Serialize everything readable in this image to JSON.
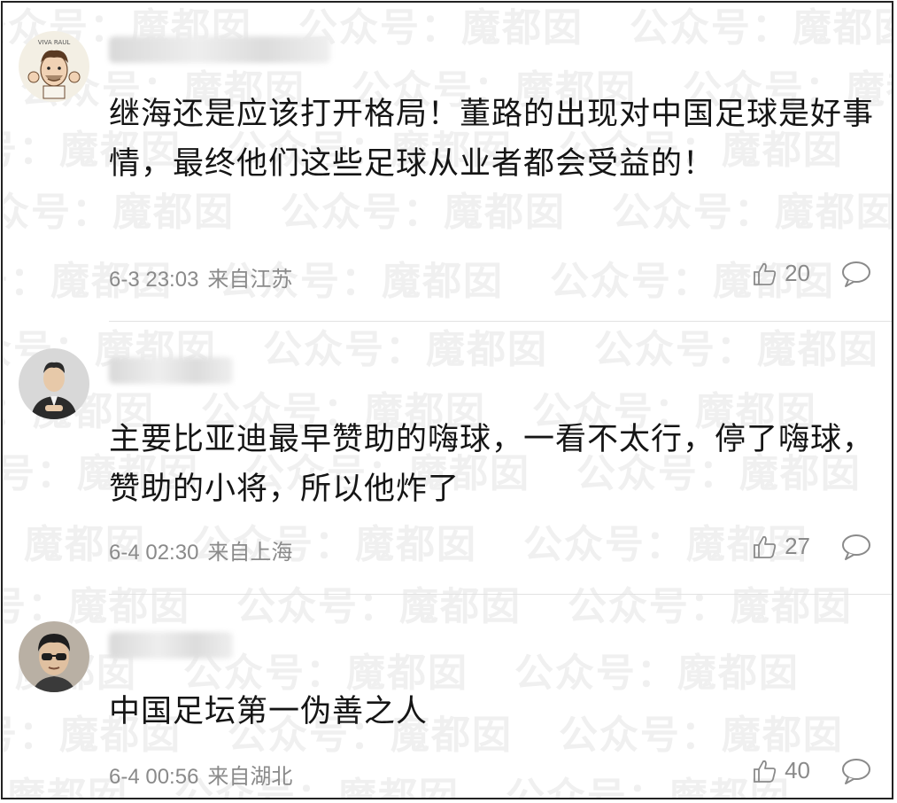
{
  "watermark": {
    "text": "公众号：魔都囡"
  },
  "comments": [
    {
      "avatar_caption": "VIVA RAUL",
      "text": "继海还是应该打开格局！董路的出现对中国足球是好事情，最终他们这些足球从业者都会受益的！",
      "time": "6-3 23:03",
      "location": "来自江苏",
      "likes": "20",
      "colors": {
        "avatar_bg": "#f3efe4",
        "avatar_fg": "#6b4a2f"
      }
    },
    {
      "text": "主要比亚迪最早赞助的嗨球，一看不太行，停了嗨球，赞助的小将，所以他炸了",
      "time": "6-4 02:30",
      "location": "来自上海",
      "likes": "27",
      "colors": {
        "avatar_bg": "#d8d8d8",
        "avatar_fg": "#2b2b2b"
      }
    },
    {
      "text": "中国足坛第一伪善之人",
      "time": "6-4 00:56",
      "location": "来自湖北",
      "likes": "40",
      "colors": {
        "avatar_bg": "#b9b0a4",
        "avatar_fg": "#1e1e1e"
      }
    }
  ],
  "icons": {
    "like": "thumbs-up-icon",
    "reply": "speech-bubble-icon"
  }
}
